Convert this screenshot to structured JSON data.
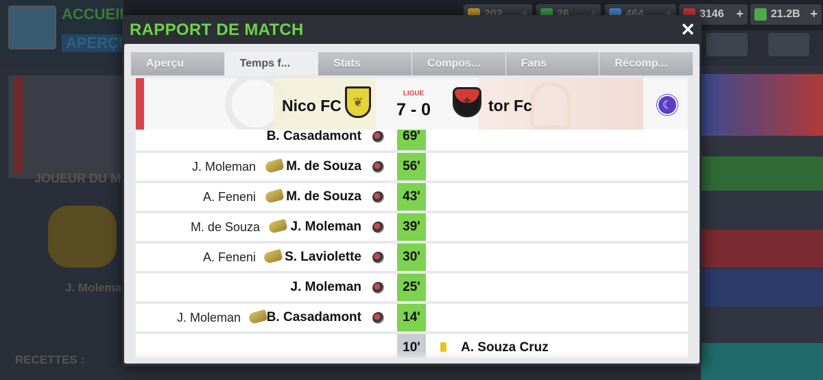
{
  "background": {
    "title_top": "ACCUEIL",
    "title_bottom": "APERÇU",
    "resources": [
      {
        "value": "202",
        "color": "#c89a2a"
      },
      {
        "value": "26",
        "color": "#3aa04a"
      },
      {
        "value": "464",
        "color": "#4a8ad0"
      },
      {
        "value": "3146",
        "color": "#d13a3a"
      },
      {
        "value": "21.2B",
        "color": "#4fa84a"
      }
    ],
    "plus_label": "+",
    "player_of_match_label": "JOUEUR DU M...",
    "player_name": "J. Molema...",
    "receipts_label": "RECETTES :"
  },
  "modal": {
    "title": "RAPPORT DE MATCH",
    "close_label": "✕",
    "tabs": [
      {
        "label": "Aperçu",
        "active": false
      },
      {
        "label": "Temps f...",
        "active": true
      },
      {
        "label": "Stats",
        "active": false
      },
      {
        "label": "Compos...",
        "active": false
      },
      {
        "label": "Fans",
        "active": false
      },
      {
        "label": "Récomp...",
        "active": false
      }
    ]
  },
  "match": {
    "home_team": "Nico FC",
    "away_team": "tor Fc",
    "competition": "LIGUE",
    "score": "7 - 0",
    "home_color": "#e5d33a",
    "away_color": "#d53b35",
    "accent_color": "#d6434a"
  },
  "events": [
    {
      "side": "home",
      "scorer": "B. Casadamont",
      "assist": "",
      "minute": "69'"
    },
    {
      "side": "home",
      "scorer": "M. de Souza",
      "assist": "J. Moleman",
      "minute": "56'"
    },
    {
      "side": "home",
      "scorer": "M. de Souza",
      "assist": "A. Feneni",
      "minute": "43'"
    },
    {
      "side": "home",
      "scorer": "J. Moleman",
      "assist": "M. de Souza",
      "minute": "39'"
    },
    {
      "side": "home",
      "scorer": "S. Laviolette",
      "assist": "A. Feneni",
      "minute": "30'"
    },
    {
      "side": "home",
      "scorer": "J. Moleman",
      "assist": "",
      "minute": "25'"
    },
    {
      "side": "home",
      "scorer": "B. Casadamont",
      "assist": "J. Moleman",
      "minute": "14'"
    },
    {
      "side": "away",
      "type": "yellow-card",
      "player": "A. Souza Cruz",
      "minute": "10'"
    }
  ]
}
